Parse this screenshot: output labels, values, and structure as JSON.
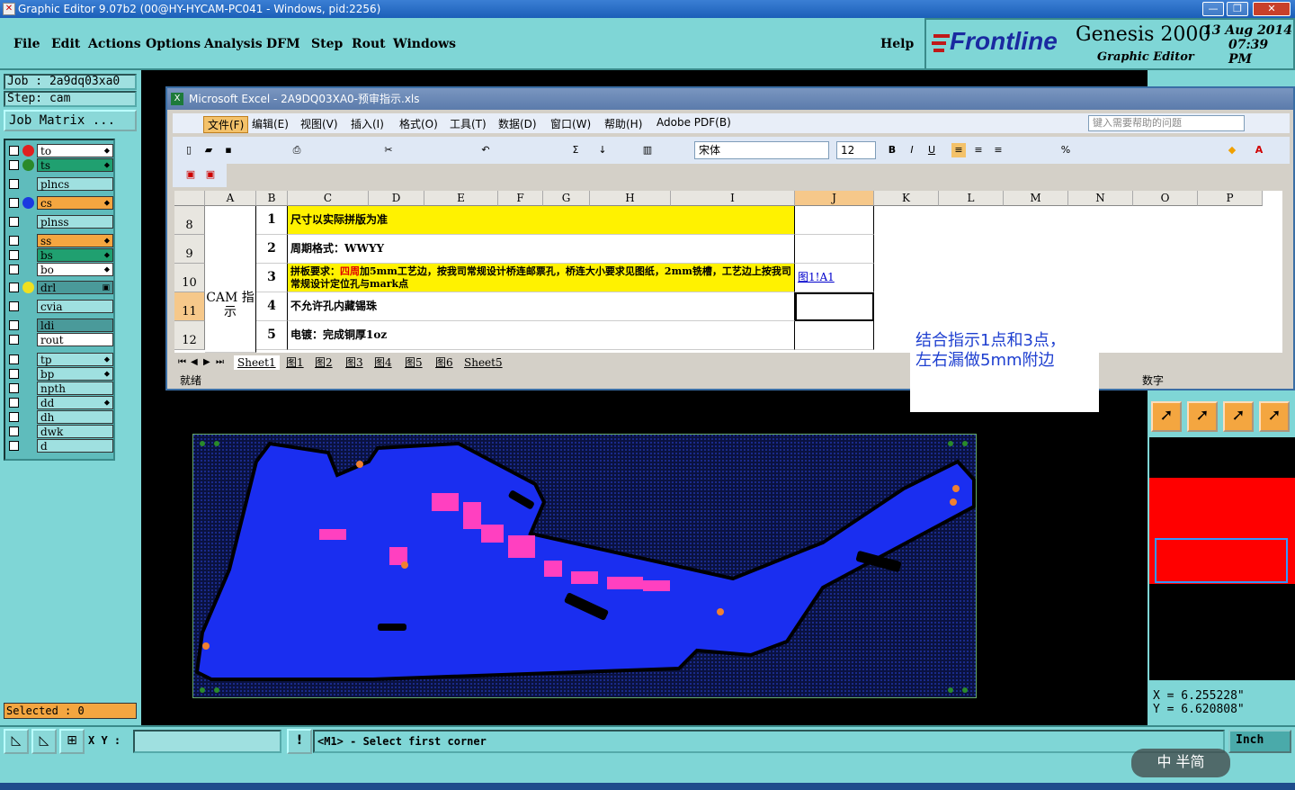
{
  "titlebar": {
    "title": "Graphic Editor 9.07b2 (00@HY-HYCAM-PC041 - Windows, pid:2256)",
    "minimize": "—",
    "restore": "❐",
    "close": "✕"
  },
  "menu": {
    "items": [
      "File",
      "Edit",
      "Actions",
      "Options",
      "Analysis",
      "DFM",
      "Step",
      "Rout",
      "Windows"
    ],
    "help": "Help"
  },
  "logo": {
    "brand": "Frontline",
    "product": "Genesis 2000",
    "subtitle": "Graphic Editor",
    "date": "13 Aug 2014",
    "time": "07:39 PM"
  },
  "left": {
    "job": "Job : 2a9dq03xa0",
    "step": "Step: cam",
    "job_matrix": "Job Matrix ...",
    "selected": "Selected : 0"
  },
  "layers": [
    {
      "name": "to",
      "dot": "#e02020",
      "style": "white",
      "mark": "⬥"
    },
    {
      "name": "ts",
      "dot": "#2a8a2a",
      "style": "green",
      "mark": "⬥"
    },
    {
      "name": "plncs",
      "dot": "",
      "style": "",
      "mark": ""
    },
    {
      "name": "cs",
      "dot": "#1a3ae0",
      "style": "orange",
      "mark": "⬥"
    },
    {
      "name": "plnss",
      "dot": "",
      "style": "",
      "mark": ""
    },
    {
      "name": "ss",
      "dot": "",
      "style": "orange",
      "mark": "⬥"
    },
    {
      "name": "bs",
      "dot": "",
      "style": "green",
      "mark": "⬥"
    },
    {
      "name": "bo",
      "dot": "",
      "style": "white",
      "mark": "⬥"
    },
    {
      "name": "drl",
      "dot": "#f0e020",
      "style": "darkteal",
      "mark": "▣"
    },
    {
      "name": "cvia",
      "dot": "",
      "style": "",
      "mark": ""
    },
    {
      "name": "ldi",
      "dot": "",
      "style": "darkteal",
      "mark": ""
    },
    {
      "name": "rout",
      "dot": "",
      "style": "white",
      "mark": ""
    },
    {
      "name": "tp",
      "dot": "",
      "style": "",
      "mark": "⬥"
    },
    {
      "name": "bp",
      "dot": "",
      "style": "",
      "mark": "⬥"
    },
    {
      "name": "npth",
      "dot": "",
      "style": "",
      "mark": ""
    },
    {
      "name": "dd",
      "dot": "",
      "style": "",
      "mark": "⬥"
    },
    {
      "name": "dh",
      "dot": "",
      "style": "",
      "mark": ""
    },
    {
      "name": "dwk",
      "dot": "",
      "style": "",
      "mark": ""
    },
    {
      "name": "d",
      "dot": "",
      "style": "",
      "mark": ""
    }
  ],
  "coords": {
    "x": "X = 6.255228\"",
    "y": "Y = 6.620808\""
  },
  "bottom": {
    "xy_label": "X Y :",
    "prompt": "<M1> - Select first corner",
    "units": "Inch",
    "warn": "!"
  },
  "excel": {
    "title": "Microsoft Excel - 2A9DQ03XA0-预审指示.xls",
    "menu": [
      "文件(F)",
      "编辑(E)",
      "视图(V)",
      "插入(I)",
      "格式(O)",
      "工具(T)",
      "数据(D)",
      "窗口(W)",
      "帮助(H)",
      "Adobe PDF(B)"
    ],
    "help_placeholder": "键入需要帮助的问题",
    "font": "宋体",
    "size": "12",
    "columns": [
      "A",
      "B",
      "C",
      "D",
      "E",
      "F",
      "G",
      "H",
      "I",
      "J",
      "K",
      "L",
      "M",
      "N",
      "O",
      "P"
    ],
    "rows": [
      "8",
      "9",
      "10",
      "11",
      "12"
    ],
    "cam_label": "CAM 指示",
    "items": [
      {
        "num": "1",
        "text": "尺寸以实际拼版为准",
        "link": ""
      },
      {
        "num": "2",
        "text": "周期格式：WWYY",
        "link": ""
      },
      {
        "num": "3",
        "text_pre": "拼板要求：",
        "text_red": "四周",
        "text_post": "加5mm工艺边，按我司常规设计桥连邮票孔，桥连大小要求见图纸，2mm铣槽，工艺边上按我司常规设计定位孔与mark点",
        "link": "图1!A1"
      },
      {
        "num": "4",
        "text": "不允许孔内藏锡珠",
        "link": ""
      },
      {
        "num": "5",
        "text": "电镀：完成铜厚1oz",
        "link": ""
      }
    ],
    "sheets": [
      "Sheet1",
      "图1",
      "图2",
      "图3",
      "图4",
      "图5",
      "图6",
      "Sheet5"
    ],
    "status": "就绪",
    "status_right": "数字"
  },
  "note": {
    "line1": "结合指示1点和3点，",
    "line2": "左右漏做5mm附边"
  },
  "watermark": "中 半简",
  "colors": {
    "panel": "#7fd6d6",
    "board": "#1a2ef0",
    "highlight": "#fff200",
    "orange": "#f4a640"
  }
}
